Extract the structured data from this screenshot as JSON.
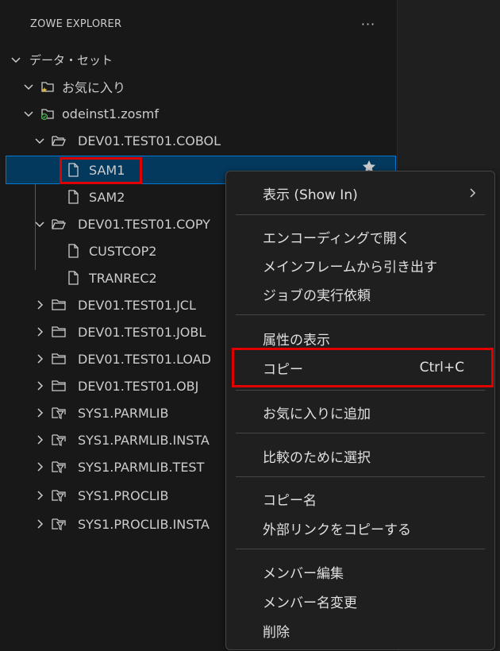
{
  "panel": {
    "title": "ZOWE EXPLORER",
    "more_label": "···"
  },
  "tree": {
    "root": "データ・セット",
    "favorites": "お気に入り",
    "profile": "odeinst1.zosmf",
    "items": [
      "DEV01.TEST01.COBOL",
      "SAM1",
      "SAM2",
      "DEV01.TEST01.COPY",
      "CUSTCOP2",
      "TRANREC2",
      "DEV01.TEST01.JCL",
      "DEV01.TEST01.JOBL",
      "DEV01.TEST01.LOAD",
      "DEV01.TEST01.OBJ",
      "SYS1.PARMLIB",
      "SYS1.PARMLIB.INSTA",
      "SYS1.PARMLIB.TEST",
      "SYS1.PROCLIB",
      "SYS1.PROCLIB.INSTA"
    ]
  },
  "menu": {
    "show_in": "表示 (Show In)",
    "open_encoding": "エンコーディングで開く",
    "pull_mainframe": "メインフレームから引き出す",
    "submit_job": "ジョブの実行依頼",
    "show_attributes": "属性の表示",
    "copy": "コピー",
    "copy_shortcut": "Ctrl+C",
    "add_favorites": "お気に入りに追加",
    "select_compare": "比較のために選択",
    "copy_name": "コピー名",
    "copy_external_link": "外部リンクをコピーする",
    "edit_member": "メンバー編集",
    "rename_member": "メンバー名変更",
    "delete": "削除"
  },
  "colors": {
    "highlight": "#e00000",
    "selection": "#04395e",
    "background": "#181818"
  }
}
